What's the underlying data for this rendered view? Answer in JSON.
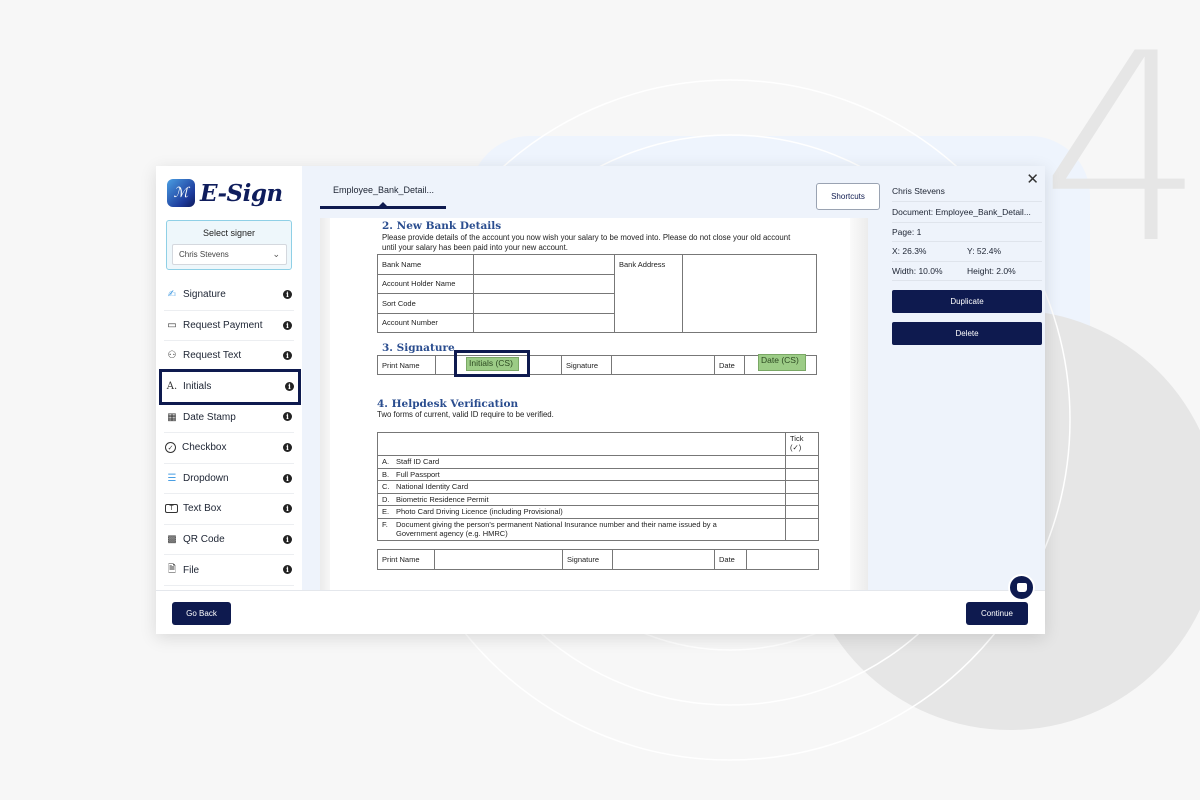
{
  "background": {
    "step_number": "4"
  },
  "app": {
    "logo_text": "E-Sign",
    "logo_mark": "ℳ",
    "brand_color": "#0e1a4f"
  },
  "signer": {
    "label": "Select signer",
    "selected": "Chris Stevens"
  },
  "tools": [
    {
      "label": "Signature",
      "icon": "signature-icon",
      "glyph": "✍"
    },
    {
      "label": "Request Payment",
      "icon": "credit-card-icon",
      "glyph": "▭"
    },
    {
      "label": "Request Text",
      "icon": "person-text-icon",
      "glyph": "⚇"
    },
    {
      "label": "Initials",
      "icon": "initials-icon",
      "glyph": "A.",
      "selected": true
    },
    {
      "label": "Date Stamp",
      "icon": "calendar-icon",
      "glyph": "▦"
    },
    {
      "label": "Checkbox",
      "icon": "check-circle-icon",
      "glyph": "✓"
    },
    {
      "label": "Dropdown",
      "icon": "dropdown-icon",
      "glyph": "☰"
    },
    {
      "label": "Text Box",
      "icon": "text-box-icon",
      "glyph": "T"
    },
    {
      "label": "QR Code",
      "icon": "qr-code-icon",
      "glyph": "▩"
    },
    {
      "label": "File",
      "icon": "file-icon",
      "glyph": "🗎"
    }
  ],
  "tools_info_glyph": "i",
  "document_tab": {
    "label": "Employee_Bank_Detail..."
  },
  "shortcuts_label": "Shortcuts",
  "document": {
    "section2": {
      "title": "2. New Bank Details",
      "desc": "Please provide details of the account you now wish your salary to be moved into.  Please do not close your old account until your salary has been paid into your new account.",
      "rows": [
        "Bank Name",
        "Account Holder Name",
        "Sort Code",
        "Account Number"
      ],
      "address_label": "Bank Address"
    },
    "section3": {
      "title": "3. Signature",
      "print_name": "Print Name",
      "signature": "Signature",
      "date": "Date",
      "initials_field": "Initials (CS)",
      "date_field": "Date (CS)"
    },
    "section4": {
      "title": "4. Helpdesk Verification",
      "desc": "Two forms of current, valid ID require to be verified.",
      "tick_header": "Tick (✓)",
      "items": [
        {
          "letter": "A.",
          "text": "Staff ID Card"
        },
        {
          "letter": "B.",
          "text": "Full Passport"
        },
        {
          "letter": "C.",
          "text": "National Identity Card"
        },
        {
          "letter": "D.",
          "text": "Biometric Residence Permit"
        },
        {
          "letter": "E.",
          "text": "Photo Card Driving Licence (including Provisional)"
        },
        {
          "letter": "F.",
          "text": "Document giving the person's permanent National Insurance number and their name issued by a Government agency (e.g. HMRC)"
        }
      ],
      "print_name": "Print Name",
      "signature": "Signature",
      "date": "Date"
    }
  },
  "properties": {
    "signer_name": "Chris Stevens",
    "document": "Document: Employee_Bank_Detail...",
    "page": "Page: 1",
    "x": "X: 26.3%",
    "y": "Y: 52.4%",
    "width": "Width: 10.0%",
    "height": "Height: 2.0%",
    "duplicate_label": "Duplicate",
    "delete_label": "Delete",
    "close_glyph": "✕"
  },
  "footer": {
    "back_label": "Go Back",
    "continue_label": "Continue"
  }
}
